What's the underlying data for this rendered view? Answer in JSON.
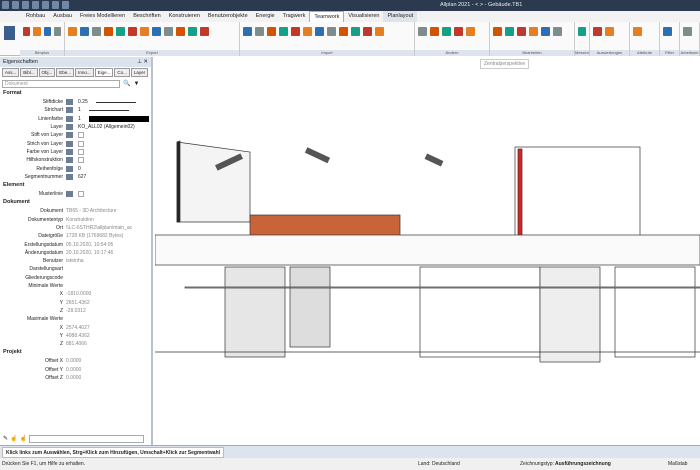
{
  "title": "Allplan 2021 - < > - Gebäude.TB1",
  "menu": [
    "Rohbau",
    "Ausbau",
    "Freies Modellieren",
    "Beschriften",
    "Konstruieren",
    "Benutzerobjekte",
    "Energie",
    "Tragwerk",
    "Teamwork",
    "Visualisieren",
    "Planlayout"
  ],
  "menu_active": "Teamwork",
  "ribbon_groups": [
    "Bimplus",
    "Export",
    "Import",
    "Ändern",
    "Bearbeiten",
    "Messen",
    "Auswertungen",
    "Attribute",
    "Filter",
    "Arbeitsum"
  ],
  "panel": {
    "title": "Eigenschaften",
    "tabs": [
      "Ass...",
      "Bibl...",
      "Obj...",
      "Ebe...",
      "Inno...",
      "Eige...",
      "Co...",
      "Layer"
    ],
    "active_tab": "Eige...",
    "combo": "Dokument",
    "sections": {
      "format": "Format",
      "element": "Element",
      "dokument": "Dokument",
      "projekt": "Projekt"
    },
    "format": [
      {
        "k": "Stiftdicke",
        "v": "0.25"
      },
      {
        "k": "Strichart",
        "v": "1"
      },
      {
        "k": "Linienfarbe",
        "v": "1"
      },
      {
        "k": "Layer",
        "v": "KO_ALL02 (Allgemein02)"
      },
      {
        "k": "Stift von Layer",
        "v": ""
      },
      {
        "k": "Strich von Layer",
        "v": ""
      },
      {
        "k": "Farbe von Layer",
        "v": ""
      },
      {
        "k": "Hilfskonstruktion",
        "v": ""
      },
      {
        "k": "Reihenfolge",
        "v": "0"
      },
      {
        "k": "Segmentnummer",
        "v": "627"
      }
    ],
    "element": [
      {
        "k": "Musterlinie",
        "v": ""
      }
    ],
    "dokument": [
      {
        "k": "Dokument",
        "v": "TB65 - 3D Architecture"
      },
      {
        "k": "Dokumententyp",
        "v": "Konstruktion"
      },
      {
        "k": "Ort",
        "v": "\\\\LC-6STHR2\\allplan\\main_ac"
      },
      {
        "k": "Dateigröße",
        "v": "1728 KB (1769682 Bytes)"
      },
      {
        "k": "Erstellungsdatum",
        "v": "05.10.2020, 10:54:05"
      },
      {
        "k": "Änderungsdatum",
        "v": "20.10.2020, 10:17:46"
      },
      {
        "k": "Benutzer",
        "v": "tsteinha"
      },
      {
        "k": "Darstellungsart",
        "v": ""
      },
      {
        "k": "Gliederungscode",
        "v": ""
      }
    ],
    "min_label": "Minimale Werte",
    "min": [
      {
        "k": "X",
        "v": "-1810.0000"
      },
      {
        "k": "Y",
        "v": "2651.4362"
      },
      {
        "k": "Z",
        "v": "-28.0312"
      }
    ],
    "max_label": "Maximale Werte",
    "max": [
      {
        "k": "X",
        "v": "2574.4027"
      },
      {
        "k": "Y",
        "v": "4088.4362"
      },
      {
        "k": "Z",
        "v": "881.4066"
      }
    ],
    "projekt": [
      {
        "k": "Offset X",
        "v": "0.0000"
      },
      {
        "k": "Offset Y",
        "v": "0.0000"
      },
      {
        "k": "Offset Z",
        "v": "0.0000"
      }
    ]
  },
  "view": {
    "label": "Zentralperspektive"
  },
  "command": "Klick links zum Auswählen, Strg+Klick zum Hinzufügen, Umschalt+Klick zur Segmentwahl",
  "status": {
    "help": "Drücken Sie F1, um Hilfe zu erhalten.",
    "land_label": "Land:",
    "land": "Deutschland",
    "typ_label": "Zeichnungstyp:",
    "typ": "Ausführungszeichnung",
    "scale_label": "Maßstab"
  }
}
